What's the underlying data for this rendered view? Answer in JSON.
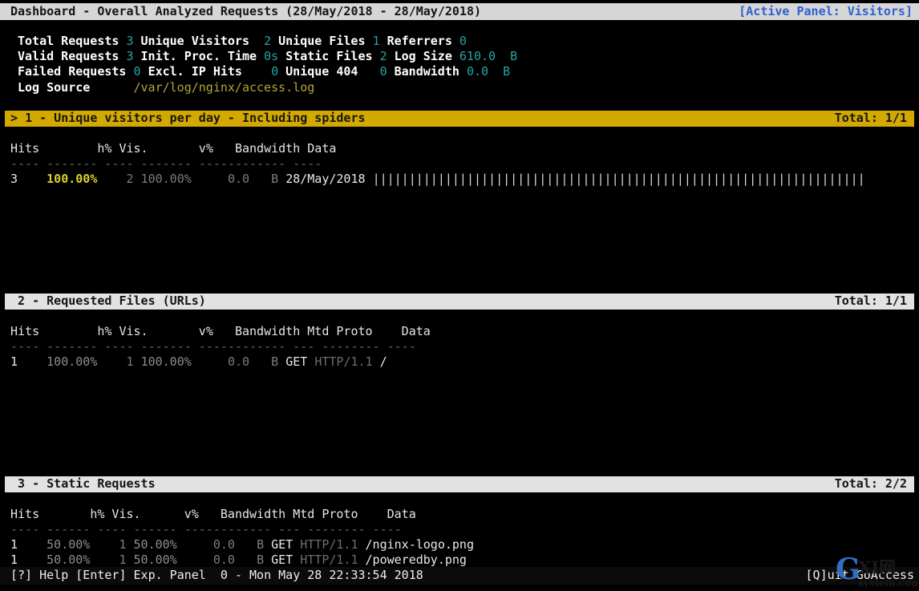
{
  "header": {
    "title": "Dashboard - Overall Analyzed Requests (28/May/2018 - 28/May/2018)",
    "active_panel": "[Active Panel: Visitors]",
    "accent_blue": "#2f5fd0",
    "bar_bg": "#d6d6d6"
  },
  "stats": {
    "rows": [
      [
        {
          "label": "Total Requests",
          "value": "3"
        },
        {
          "label": "Unique Visitors",
          "value": "2"
        },
        {
          "label": "Unique Files",
          "value": "1"
        },
        {
          "label": "Referrers",
          "value": "0"
        }
      ],
      [
        {
          "label": "Valid Requests",
          "value": "3"
        },
        {
          "label": "Init. Proc. Time",
          "value": "0s"
        },
        {
          "label": "Static Files",
          "value": "2"
        },
        {
          "label": "Log Size",
          "value": "610.0",
          "unit": "B"
        }
      ],
      [
        {
          "label": "Failed Requests",
          "value": "0"
        },
        {
          "label": "Excl. IP Hits",
          "value": "0"
        },
        {
          "label": "Unique 404",
          "value": "0"
        },
        {
          "label": "Bandwidth",
          "value": "0.0",
          "unit": "B"
        }
      ]
    ],
    "log_source_label": "Log Source",
    "log_source_value": "/var/log/nginx/access.log",
    "label_color": "#ffffff",
    "value_color": "#23a6a6",
    "path_color": "#b5a536"
  },
  "panels": [
    {
      "id": 1,
      "marker": ">",
      "title": "1 - Unique visitors per day - Including spiders",
      "total": "Total: 1/1",
      "active": true,
      "bg_color": "#d3a900",
      "columns": "Hits        h% Vis.       v%   Bandwidth Data",
      "dashes": "---- ------- ---- ------- ------------ ----",
      "rows": [
        {
          "hits": "3",
          "h_pct": "100.00%",
          "vis": "2",
          "v_pct": "100.00%",
          "bandwidth": "0.0",
          "unit": "B",
          "data": "28/May/2018",
          "bar_count": 68
        }
      ]
    },
    {
      "id": 2,
      "marker": "",
      "title": "2 - Requested Files (URLs)",
      "total": "Total: 1/1",
      "active": false,
      "bg_color": "#e2e2e2",
      "columns": "Hits        h% Vis.       v%   Bandwidth Mtd Proto    Data",
      "dashes": "---- ------- ---- ------- ------------ --- -------- ----",
      "rows": [
        {
          "hits": "1",
          "h_pct": "100.00%",
          "vis": "1",
          "v_pct": "100.00%",
          "bandwidth": "0.0",
          "unit": "B",
          "method": "GET",
          "proto": "HTTP/1.1",
          "data": "/"
        }
      ]
    },
    {
      "id": 3,
      "marker": "",
      "title": "3 - Static Requests",
      "total": "Total: 2/2",
      "active": false,
      "bg_color": "#e2e2e2",
      "columns": "Hits       h% Vis.      v%   Bandwidth Mtd Proto    Data",
      "dashes": "---- ------ ---- ------ ------------ --- -------- ----",
      "rows": [
        {
          "hits": "1",
          "h_pct": "50.00%",
          "vis": "1",
          "v_pct": "50.00%",
          "bandwidth": "0.0",
          "unit": "B",
          "method": "GET",
          "proto": "HTTP/1.1",
          "data": "/nginx-logo.png"
        },
        {
          "hits": "1",
          "h_pct": "50.00%",
          "vis": "1",
          "v_pct": "50.00%",
          "bandwidth": "0.0",
          "unit": "B",
          "method": "GET",
          "proto": "HTTP/1.1",
          "data": "/poweredby.png"
        }
      ]
    }
  ],
  "status": {
    "left": "[?] Help [Enter] Exp. Panel  0 - Mon May 28 22:33:54 2018",
    "right": "[Q]uit GoAccess"
  },
  "watermark": {
    "letter": "G",
    "text": "XI网",
    "subtext": "system.com",
    "color": "#2f6fc4"
  }
}
